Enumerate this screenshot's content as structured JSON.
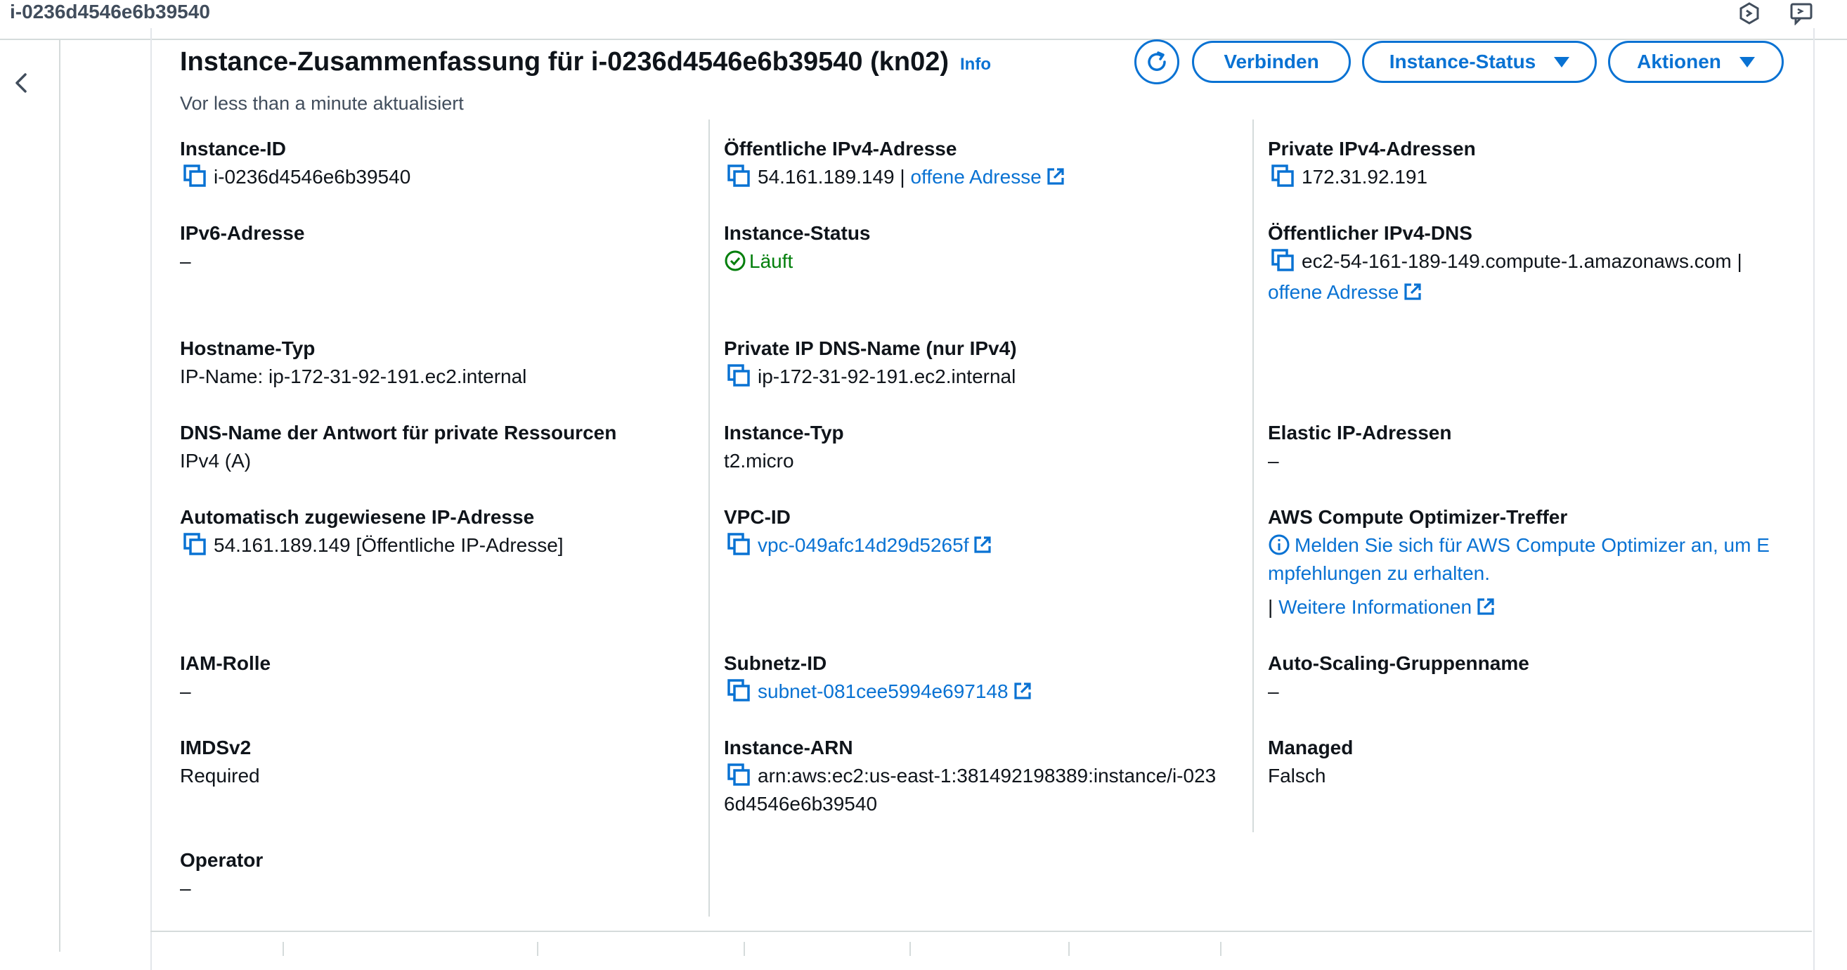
{
  "tab": {
    "title": "i-0236d4546e6b39540"
  },
  "header": {
    "title": "Instance-Zusammenfassung für i-0236d4546e6b39540 (kn02)",
    "info": "Info",
    "subtitle": "Vor less than a minute aktualisiert",
    "buttons": {
      "connect": "Verbinden",
      "instance_status": "Instance-Status",
      "actions": "Aktionen"
    }
  },
  "col1": {
    "instance_id": {
      "label": "Instance-ID",
      "value": "i-0236d4546e6b39540"
    },
    "ipv6": {
      "label": "IPv6-Adresse",
      "value": "–"
    },
    "hostname_type": {
      "label": "Hostname-Typ",
      "value": "IP-Name: ip-172-31-92-191.ec2.internal"
    },
    "dns_response": {
      "label": "DNS-Name der Antwort für private Ressourcen",
      "value": "IPv4 (A)"
    },
    "auto_ip": {
      "label": "Automatisch zugewiesene IP-Adresse",
      "value": "54.161.189.149 [Öffentliche IP-Adresse]"
    },
    "iam_role": {
      "label": "IAM-Rolle",
      "value": "–"
    },
    "imdsv2": {
      "label": "IMDSv2",
      "value": "Required"
    },
    "operator": {
      "label": "Operator",
      "value": "–"
    }
  },
  "col2": {
    "public_ipv4": {
      "label": "Öffentliche IPv4-Adresse",
      "value": "54.161.189.149 |",
      "link": "offene Adresse"
    },
    "instance_status": {
      "label": "Instance-Status",
      "value": "Läuft"
    },
    "private_dns": {
      "label": "Private IP DNS-Name (nur IPv4)",
      "value": "ip-172-31-92-191.ec2.internal"
    },
    "instance_type": {
      "label": "Instance-Typ",
      "value": "t2.micro"
    },
    "vpc_id": {
      "label": "VPC-ID",
      "value": "vpc-049afc14d29d5265f"
    },
    "subnet_id": {
      "label": "Subnetz-ID",
      "value": "subnet-081cee5994e697148"
    },
    "arn": {
      "label": "Instance-ARN",
      "line1": "arn:aws:ec2:us-east-1:381492198389:instance/i-023",
      "line2": "6d4546e6b39540"
    }
  },
  "col3": {
    "private_ipv4": {
      "label": "Private IPv4-Adressen",
      "value": "172.31.92.191"
    },
    "public_dns": {
      "label": "Öffentlicher IPv4-DNS",
      "value": "ec2-54-161-189-149.compute-1.amazonaws.com |",
      "link": "offene Adresse"
    },
    "elastic_ip": {
      "label": "Elastic IP-Adressen",
      "value": "–"
    },
    "optimizer": {
      "label": "AWS Compute Optimizer-Treffer",
      "line1": "Melden Sie sich für AWS Compute Optimizer an, um E",
      "line2": "mpfehlungen zu erhalten.",
      "sep": "|",
      "more": "Weitere Informationen"
    },
    "asg": {
      "label": "Auto-Scaling-Gruppenname",
      "value": "–"
    },
    "managed": {
      "label": "Managed",
      "value": "Falsch"
    }
  },
  "colors": {
    "link": "#0972d3",
    "success": "#037f0c",
    "text": "#0f141a",
    "border": "#d5dbdb"
  }
}
